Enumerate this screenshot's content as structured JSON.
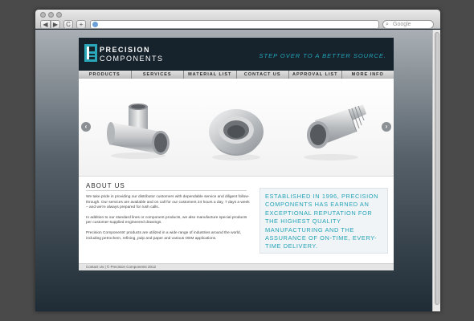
{
  "browser": {
    "search_placeholder": "Google",
    "back_label": "◀",
    "forward_label": "▶",
    "reload_label": "C",
    "add_label": "+"
  },
  "site": {
    "logo_top": "PRECISION",
    "logo_bottom": "COMPONENTS",
    "tagline": "STEP OVER TO A BETTER SOURCE.",
    "accent": "#22a3b7",
    "header_bg": "#16232d"
  },
  "nav": [
    {
      "label": "PRODUCTS"
    },
    {
      "label": "SERVICES"
    },
    {
      "label": "MATERIAL LIST"
    },
    {
      "label": "CONTACT US"
    },
    {
      "label": "APPROVAL LIST"
    },
    {
      "label": "MORE INFO"
    }
  ],
  "slider": {
    "left_arrow": "‹",
    "right_arrow": "›",
    "images": [
      "pipe-tee-image",
      "flanged-ring-image",
      "threaded-nipple-image"
    ]
  },
  "about": {
    "title": "ABOUT US",
    "paragraphs": [
      "We take pride in providing our distributor customers with dependable service and diligent follow-through. Our services are available and on call for our customers 24 hours a day, 7 days a week – and we're always prepared for rush calls.",
      "In addition to our standard lines or component products, we also manufacture special products per customer-supplied engineered drawings.",
      "Precision Components' products are utilized in a wide range of industries around the world, including petrochem, refining, pulp and paper and various OEM applications."
    ],
    "quote": "ESTABLISHED IN 1996, PRECISION COMPONENTS HAS EARNED AN EXCEPTIONAL REPUTATION FOR THE HIGHEST QUALITY MANUFACTURING AND THE ASSURANCE OF ON-TIME, EVERY-TIME DELIVERY."
  },
  "footer": {
    "text": "Contact Us  |  © Precision Components 2012"
  }
}
